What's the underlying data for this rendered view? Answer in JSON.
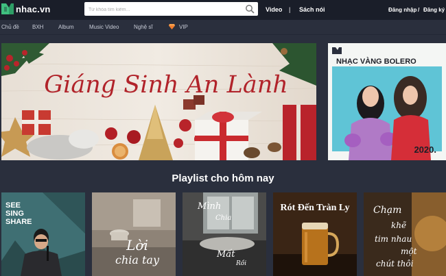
{
  "brand": {
    "name": "nhac.vn",
    "accent": "#e8453c",
    "logo_green": "#3fbf7f"
  },
  "search": {
    "placeholder": "Từ khóa tìm kiếm..."
  },
  "top_nav": {
    "video": "Video",
    "separator": "|",
    "audiobook": "Sách nói"
  },
  "auth": {
    "login": "Đăng nhập",
    "divider": "/",
    "register": "Đăng ký"
  },
  "sub_nav": [
    {
      "label": "Chủ đề"
    },
    {
      "label": "BXH"
    },
    {
      "label": "Album"
    },
    {
      "label": "Music Video"
    },
    {
      "label": "Nghệ sĩ"
    },
    {
      "label": "VIP"
    }
  ],
  "banner_main": {
    "title": "Giáng Sinh An Lành"
  },
  "banner_side": {
    "title": "NHẠC VÀNG BOLERO",
    "year": "2020."
  },
  "section": {
    "title": "Playlist cho hôm nay"
  },
  "playlists": [
    {
      "line1": "SEE",
      "line2": "SING",
      "line3": "SHARE"
    },
    {
      "title": "Lời",
      "subtitle": "chia tay"
    },
    {
      "title": "Mình",
      "line2": "Chia",
      "line3": "Mất",
      "line4": "Rồi"
    },
    {
      "title": "Rót Đến Tràn Ly"
    },
    {
      "line1": "Chạm",
      "line2": "khẽ",
      "line3": "tim nhau",
      "line4": "một",
      "line5": "chút thôi"
    }
  ]
}
